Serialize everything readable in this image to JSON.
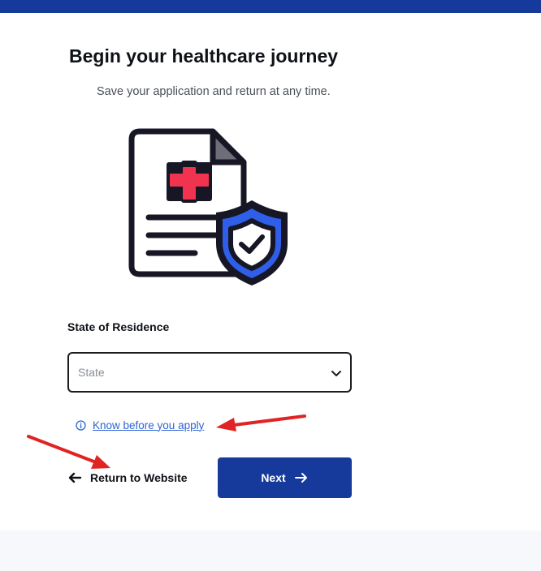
{
  "header": {
    "bar_color": "#163a9c"
  },
  "main": {
    "title": "Begin your healthcare journey",
    "subtitle": "Save your application and return at any time."
  },
  "illustration": {
    "icons": [
      "medical-document-icon",
      "shield-check-icon"
    ],
    "colors": {
      "outline": "#161625",
      "cross": "#f0344f",
      "shield": "#2f5ee8"
    }
  },
  "form": {
    "state_label": "State of Residence",
    "state_select": {
      "placeholder": "State",
      "value": ""
    }
  },
  "links": {
    "know_before": "Know before you apply"
  },
  "actions": {
    "return_label": "Return to Website",
    "next_label": "Next"
  },
  "annotations": {
    "arrow_color": "#e02424",
    "count": 2
  }
}
